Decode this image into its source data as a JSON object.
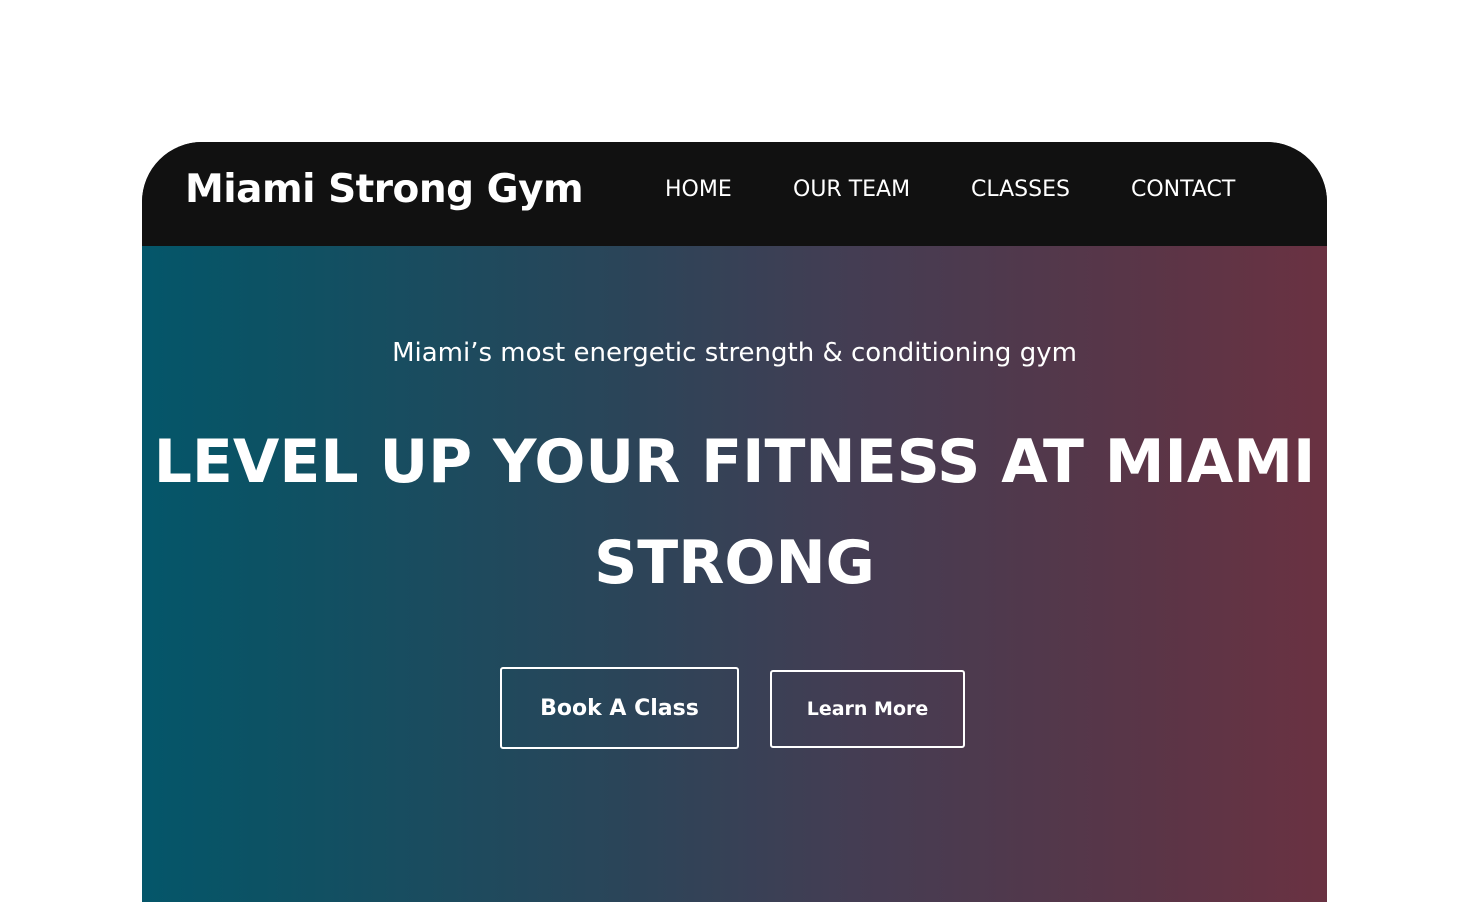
{
  "header": {
    "brand": "Miami Strong Gym",
    "nav": [
      {
        "label": "HOME"
      },
      {
        "label": "OUR TEAM"
      },
      {
        "label": "CLASSES"
      },
      {
        "label": "CONTACT"
      }
    ]
  },
  "hero": {
    "tagline": "Miami’s most energetic strength & conditioning gym",
    "headline": "LEVEL UP YOUR FITNESS AT MIAMI STRONG",
    "primary_button": "Book A Class",
    "secondary_button": "Learn More"
  },
  "colors": {
    "navbar_bg": "#111111",
    "gradient_start": "#04566a",
    "gradient_end": "#6a3242",
    "text": "#ffffff"
  }
}
